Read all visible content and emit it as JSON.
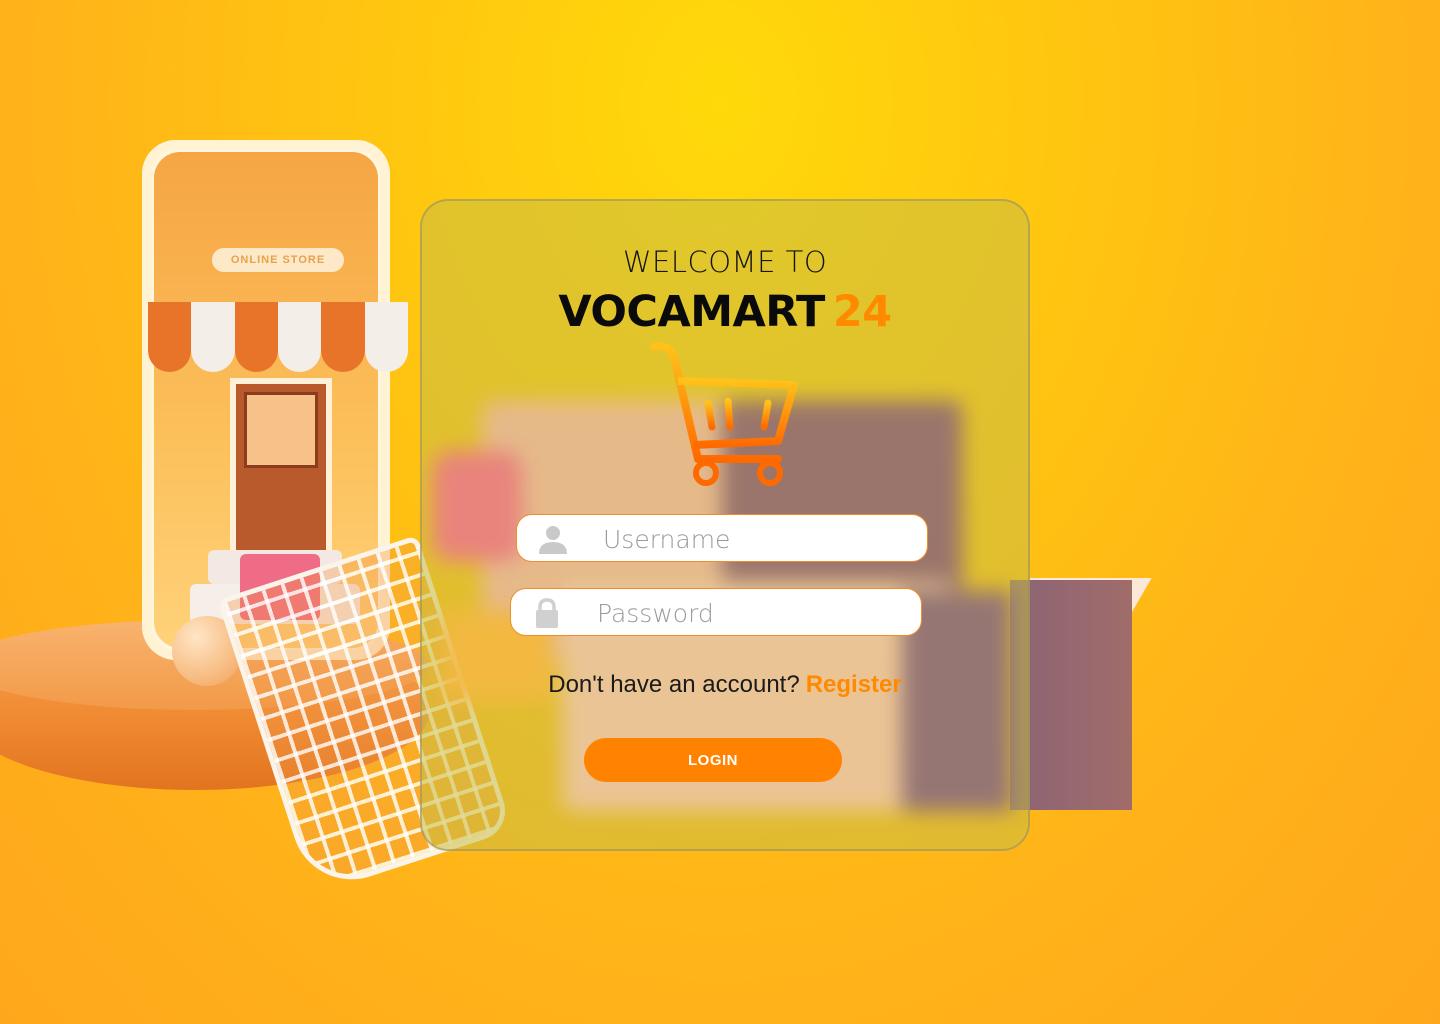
{
  "background": {
    "store_sign": "ONLINE STORE",
    "accent_color": "#ffc510"
  },
  "login_card": {
    "welcome_text": "WELCOME TO",
    "brand_name": "VOCAMART",
    "brand_number": "24",
    "logo_icon": "shopping-cart-icon",
    "username": {
      "placeholder": "Username",
      "value": "",
      "icon": "user-icon"
    },
    "password": {
      "placeholder": "Password",
      "value": "",
      "icon": "lock-icon"
    },
    "register_prompt": "Don't have an account?",
    "register_link": "Register",
    "login_button": "LOGIN",
    "colors": {
      "brand_orange": "#ff8a00",
      "button": "#ff8200",
      "field_border": "#f08c2a"
    }
  }
}
